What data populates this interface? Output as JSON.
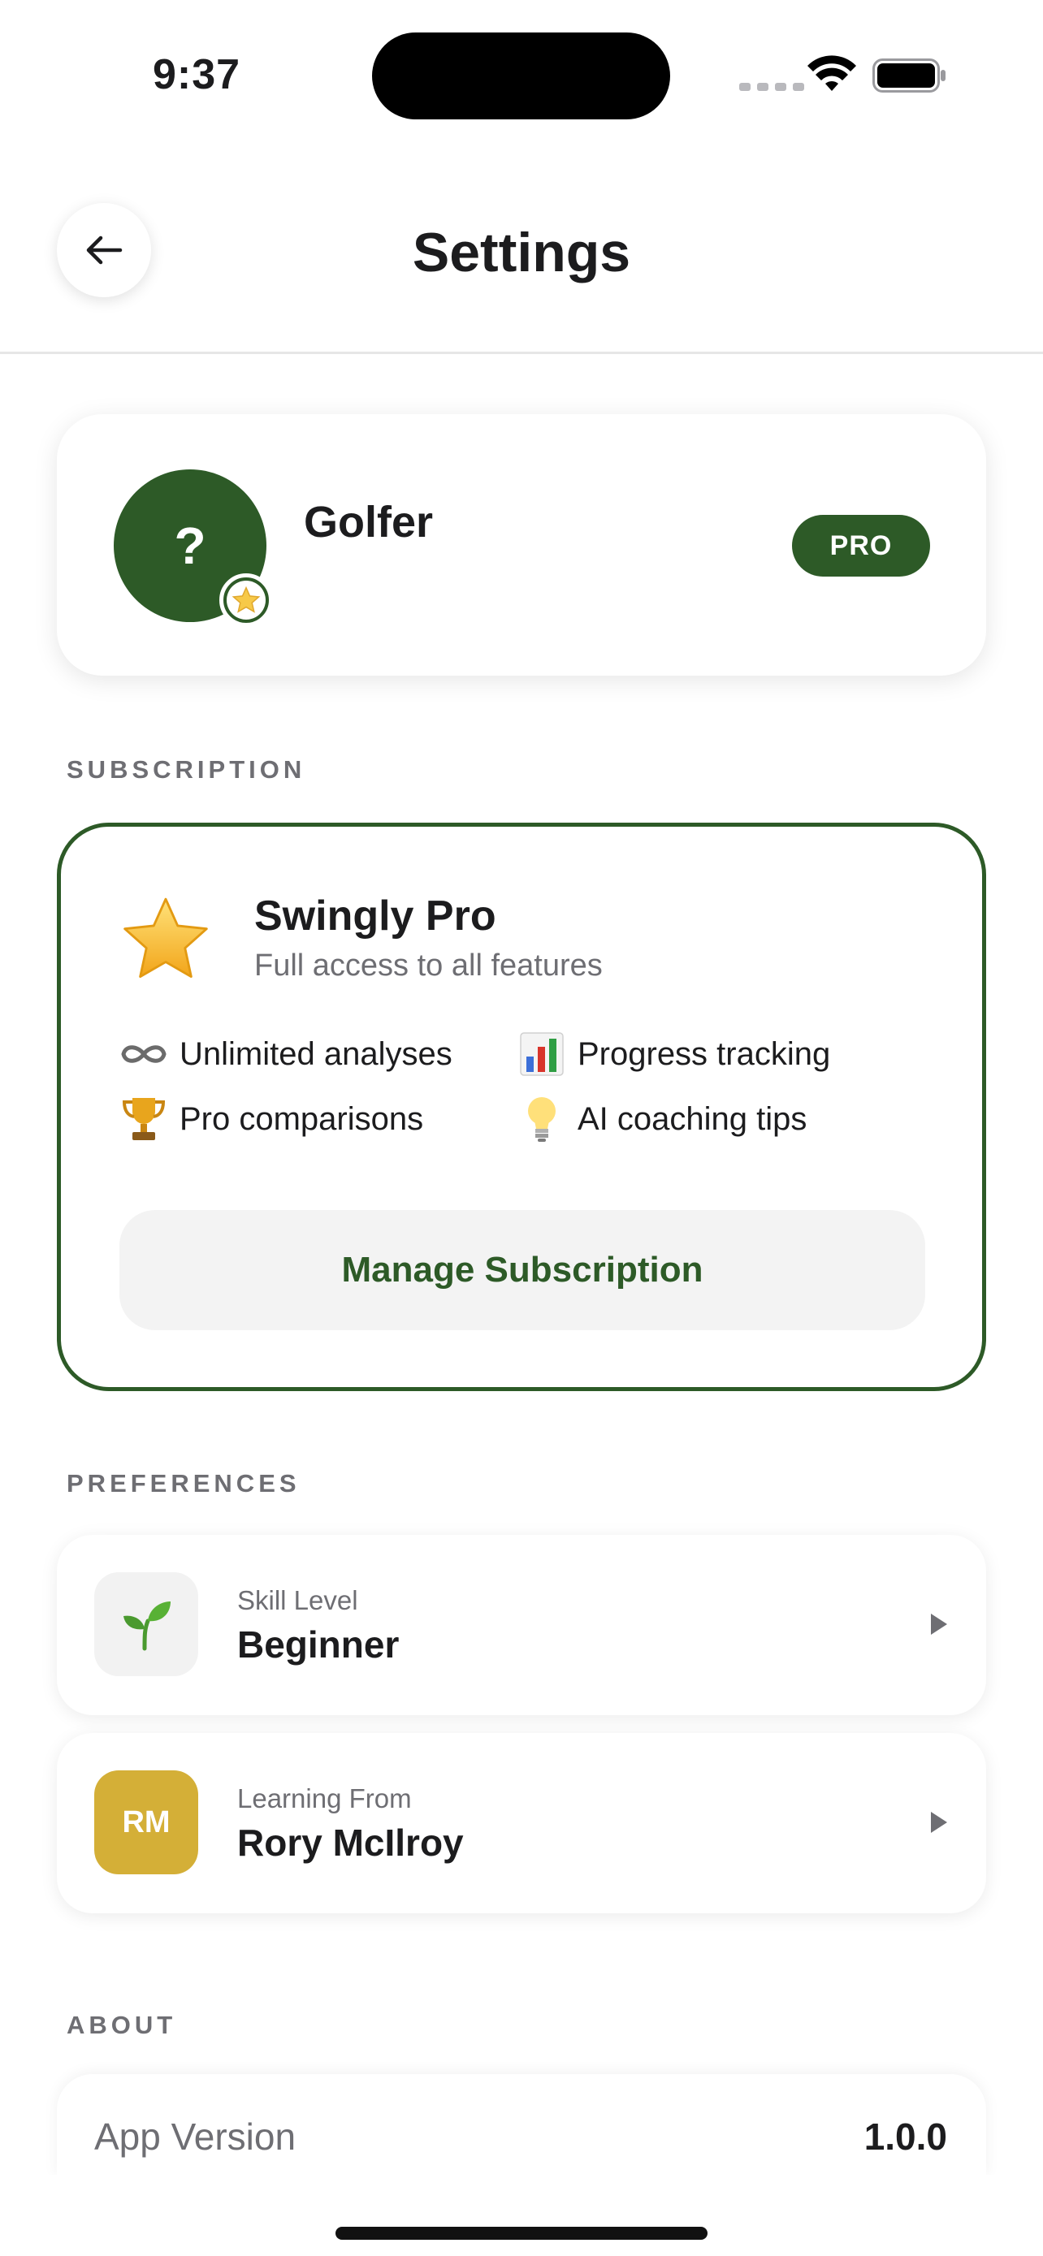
{
  "status_bar": {
    "time": "9:37"
  },
  "header": {
    "title": "Settings"
  },
  "profile": {
    "avatar_symbol": "?",
    "name": "Golfer",
    "badge": "PRO"
  },
  "sections": {
    "subscription": "SUBSCRIPTION",
    "preferences": "PREFERENCES",
    "about": "ABOUT"
  },
  "subscription": {
    "title": "Swingly Pro",
    "subtitle": "Full access to all features",
    "features": [
      {
        "icon": "infinity-icon",
        "label": "Unlimited analyses"
      },
      {
        "icon": "bar-chart-icon",
        "label": "Progress tracking"
      },
      {
        "icon": "trophy-icon",
        "label": "Pro comparisons"
      },
      {
        "icon": "lightbulb-icon",
        "label": "AI coaching tips"
      }
    ],
    "manage_label": "Manage Subscription"
  },
  "preferences": {
    "skill": {
      "label": "Skill Level",
      "value": "Beginner",
      "icon": "seedling-icon"
    },
    "learning": {
      "label": "Learning From",
      "value": "Rory McIlroy",
      "initials": "RM"
    }
  },
  "about": {
    "app_version_label": "App Version",
    "app_version": "1.0.0"
  },
  "colors": {
    "brand": "#2d5a27",
    "gold": "#d4af37",
    "muted": "#6e6e73"
  }
}
